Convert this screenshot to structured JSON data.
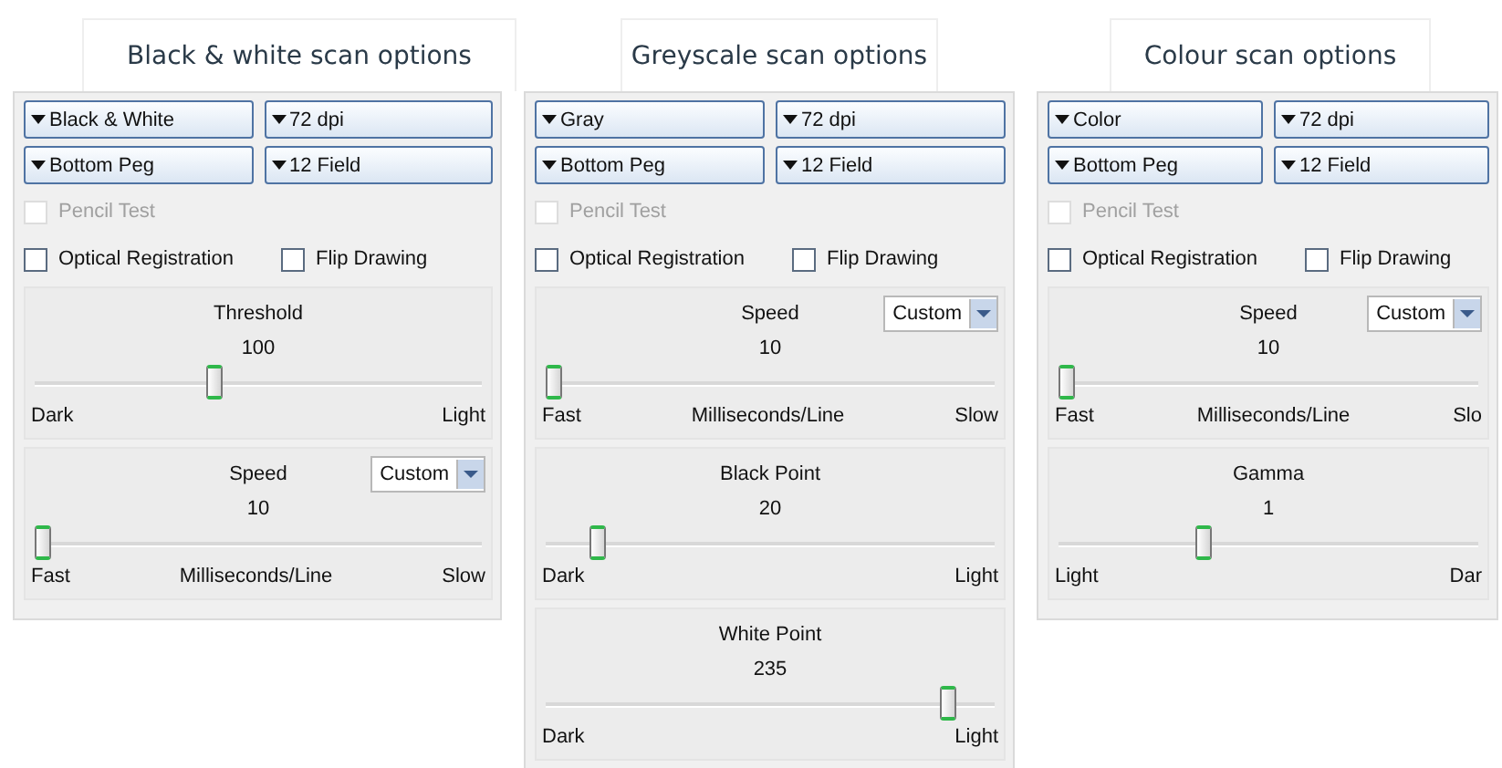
{
  "panels": [
    {
      "caption": "Black & white scan options",
      "dropdowns": [
        "Black & White",
        "72 dpi",
        "Bottom Peg",
        "12 Field"
      ],
      "checkboxes": [
        {
          "label": "Pencil Test",
          "checked": false,
          "disabled": true
        },
        {
          "label": "Optical Registration",
          "checked": false,
          "disabled": false
        },
        {
          "label": "Flip Drawing",
          "checked": false,
          "disabled": false
        }
      ],
      "sliders": [
        {
          "title": "Threshold",
          "value": "100",
          "level": 0.4,
          "min_label": "Dark",
          "max_label": "Light"
        },
        {
          "title": "Speed",
          "select": "Custom",
          "value": "10",
          "level": 0,
          "min_label": "Fast",
          "mid_label": "Milliseconds/Line",
          "max_label": "Slow"
        }
      ]
    },
    {
      "caption": "Greyscale scan options",
      "dropdowns": [
        "Gray",
        "72 dpi",
        "Bottom Peg",
        "12 Field"
      ],
      "checkboxes": [
        {
          "label": "Pencil Test",
          "checked": false,
          "disabled": true
        },
        {
          "label": "Optical Registration",
          "checked": false,
          "disabled": false
        },
        {
          "label": "Flip Drawing",
          "checked": false,
          "disabled": false
        }
      ],
      "sliders": [
        {
          "title": "Speed",
          "select": "Custom",
          "value": "10",
          "level": 0,
          "min_label": "Fast",
          "mid_label": "Milliseconds/Line",
          "max_label": "Slow"
        },
        {
          "title": "Black Point",
          "value": "20",
          "level": 0.1,
          "min_label": "Dark",
          "max_label": "Light"
        },
        {
          "title": "White Point",
          "value": "235",
          "level": 0.91,
          "min_label": "Dark",
          "max_label": "Light"
        }
      ]
    },
    {
      "caption": "Colour scan options",
      "dropdowns": [
        "Color",
        "72 dpi",
        "Bottom Peg",
        "12 Field"
      ],
      "checkboxes": [
        {
          "label": "Pencil Test",
          "checked": false,
          "disabled": true
        },
        {
          "label": "Optical Registration",
          "checked": false,
          "disabled": false
        },
        {
          "label": "Flip Drawing",
          "checked": false,
          "disabled": false
        }
      ],
      "sliders": [
        {
          "title": "Speed",
          "select": "Custom",
          "value": "10",
          "level": 0,
          "min_label": "Fast",
          "mid_label": "Milliseconds/Line",
          "max_label": "Slo"
        },
        {
          "title": "Gamma",
          "value": "1",
          "level": 0.34,
          "min_label": "Light",
          "max_label": "Dar"
        }
      ]
    }
  ]
}
